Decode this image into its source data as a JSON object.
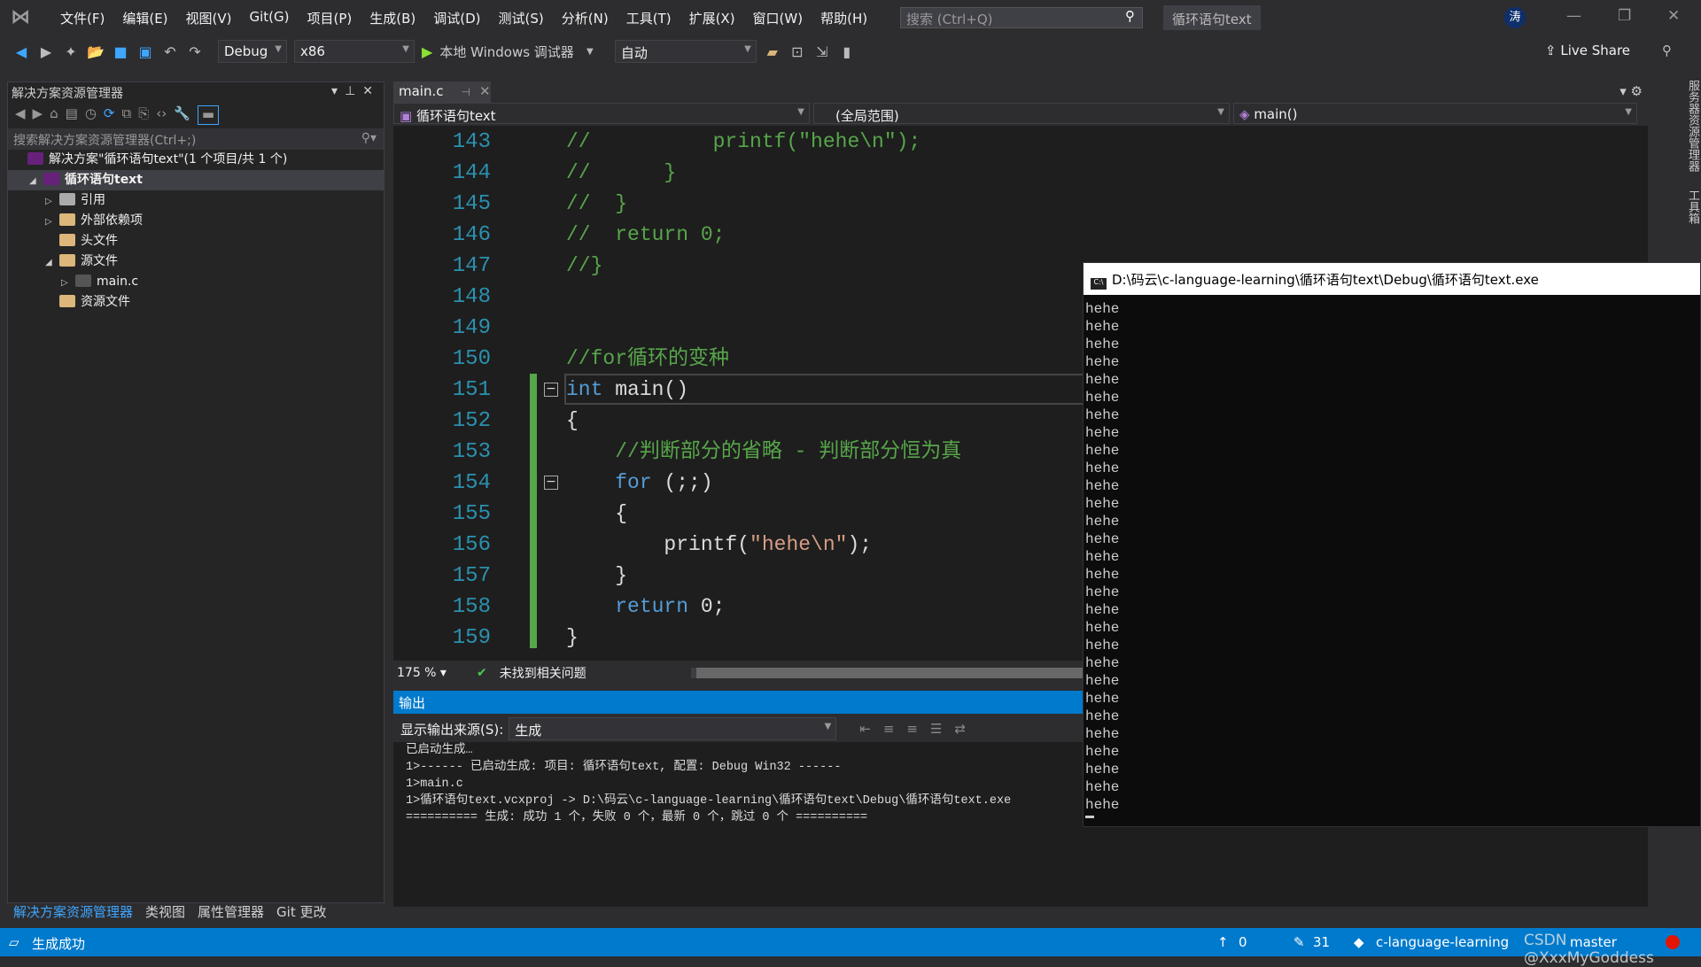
{
  "menubar": {
    "items": [
      "文件(F)",
      "编辑(E)",
      "视图(V)",
      "Git(G)",
      "项目(P)",
      "生成(B)",
      "调试(D)",
      "测试(S)",
      "分析(N)",
      "工具(T)",
      "扩展(X)",
      "窗口(W)",
      "帮助(H)"
    ],
    "search_placeholder": "搜索 (Ctrl+Q)",
    "solution_title": "循环语句text",
    "avatar": "涛"
  },
  "toolbar": {
    "config": "Debug",
    "platform": "x86",
    "run_label": "本地 Windows 调试器",
    "auto": "自动",
    "live_share": "Live Share"
  },
  "solution_explorer": {
    "title": "解决方案资源管理器",
    "search_placeholder": "搜索解决方案资源管理器(Ctrl+;)",
    "tree": [
      {
        "label": "解决方案\"循环语句text\"(1 个项目/共 1 个)",
        "icon": "solution-icon",
        "level": 0,
        "expander": ""
      },
      {
        "label": "循环语句text",
        "icon": "project-icon",
        "level": 1,
        "expander": "◢",
        "selected": true
      },
      {
        "label": "引用",
        "icon": "references-icon",
        "level": 2,
        "expander": "▷"
      },
      {
        "label": "外部依赖项",
        "icon": "folder-icon",
        "level": 2,
        "expander": "▷"
      },
      {
        "label": "头文件",
        "icon": "filter-folder-icon",
        "level": 2,
        "expander": ""
      },
      {
        "label": "源文件",
        "icon": "filter-folder-icon",
        "level": 2,
        "expander": "◢"
      },
      {
        "label": "main.c",
        "icon": "c-file-icon",
        "level": 3,
        "expander": "▷"
      },
      {
        "label": "资源文件",
        "icon": "filter-folder-icon",
        "level": 2,
        "expander": ""
      }
    ],
    "tabs": [
      "解决方案资源管理器",
      "类视图",
      "属性管理器",
      "Git 更改"
    ]
  },
  "editor": {
    "tab": "main.c",
    "nav_project": "循环语句text",
    "nav_scope": "(全局范围)",
    "nav_function": "main()",
    "zoom": "175 %",
    "issues": "未找到相关问题",
    "lines": [
      {
        "n": "143",
        "tokens": [
          [
            "//          printf(\"hehe\\n\");",
            "comment"
          ]
        ]
      },
      {
        "n": "144",
        "tokens": [
          [
            "//      }",
            "comment"
          ]
        ]
      },
      {
        "n": "145",
        "tokens": [
          [
            "//  }",
            "comment"
          ]
        ]
      },
      {
        "n": "146",
        "tokens": [
          [
            "//  return 0;",
            "comment"
          ]
        ]
      },
      {
        "n": "147",
        "tokens": [
          [
            "//}",
            "comment"
          ]
        ]
      },
      {
        "n": "148",
        "tokens": []
      },
      {
        "n": "149",
        "tokens": []
      },
      {
        "n": "150",
        "tokens": [
          [
            "//for循环的变种",
            "comment"
          ]
        ]
      },
      {
        "n": "151",
        "tokens": [
          [
            "int",
            "kw"
          ],
          [
            " main()",
            ""
          ]
        ]
      },
      {
        "n": "152",
        "tokens": [
          [
            "{",
            ""
          ]
        ]
      },
      {
        "n": "153",
        "tokens": [
          [
            "    ",
            ""
          ],
          [
            "//判断部分的省略 - 判断部分恒为真",
            "comment"
          ]
        ]
      },
      {
        "n": "154",
        "tokens": [
          [
            "    ",
            ""
          ],
          [
            "for",
            "kw"
          ],
          [
            " (;;)",
            ""
          ]
        ]
      },
      {
        "n": "155",
        "tokens": [
          [
            "    {",
            ""
          ]
        ]
      },
      {
        "n": "156",
        "tokens": [
          [
            "        printf(",
            ""
          ],
          [
            "\"hehe\\n\"",
            "str"
          ],
          [
            ");",
            ""
          ]
        ]
      },
      {
        "n": "157",
        "tokens": [
          [
            "    }",
            ""
          ]
        ]
      },
      {
        "n": "158",
        "tokens": [
          [
            "    ",
            ""
          ],
          [
            "return",
            "kw"
          ],
          [
            " 0;",
            ""
          ]
        ]
      },
      {
        "n": "159",
        "tokens": [
          [
            "}",
            ""
          ]
        ]
      }
    ]
  },
  "output": {
    "title": "输出",
    "source_label": "显示输出来源(S):",
    "source_value": "生成",
    "lines": [
      "已启动生成…",
      "1>------ 已启动生成: 项目: 循环语句text, 配置: Debug Win32 ------",
      "1>main.c",
      "1>循环语句text.vcxproj -> D:\\码云\\c-language-learning\\循环语句text\\Debug\\循环语句text.exe",
      "========== 生成: 成功 1 个，失败 0 个，最新 0 个，跳过 0 个 =========="
    ]
  },
  "console": {
    "title": "D:\\码云\\c-language-learning\\循环语句text\\Debug\\循环语句text.exe",
    "line": "hehe",
    "line_count": 29
  },
  "right_strip": [
    "服务器资源管理器",
    "工具箱"
  ],
  "statusbar": {
    "message": "生成成功",
    "up": "0",
    "edits": "31",
    "repo": "c-language-learning",
    "branch": "master",
    "watermark": "CSDN @XxxMyGoddess"
  },
  "colors": {
    "accent": "#007acc",
    "comment": "#57a64a",
    "keyword": "#569cd6",
    "string": "#d69d85",
    "line_number": "#2b91af"
  }
}
